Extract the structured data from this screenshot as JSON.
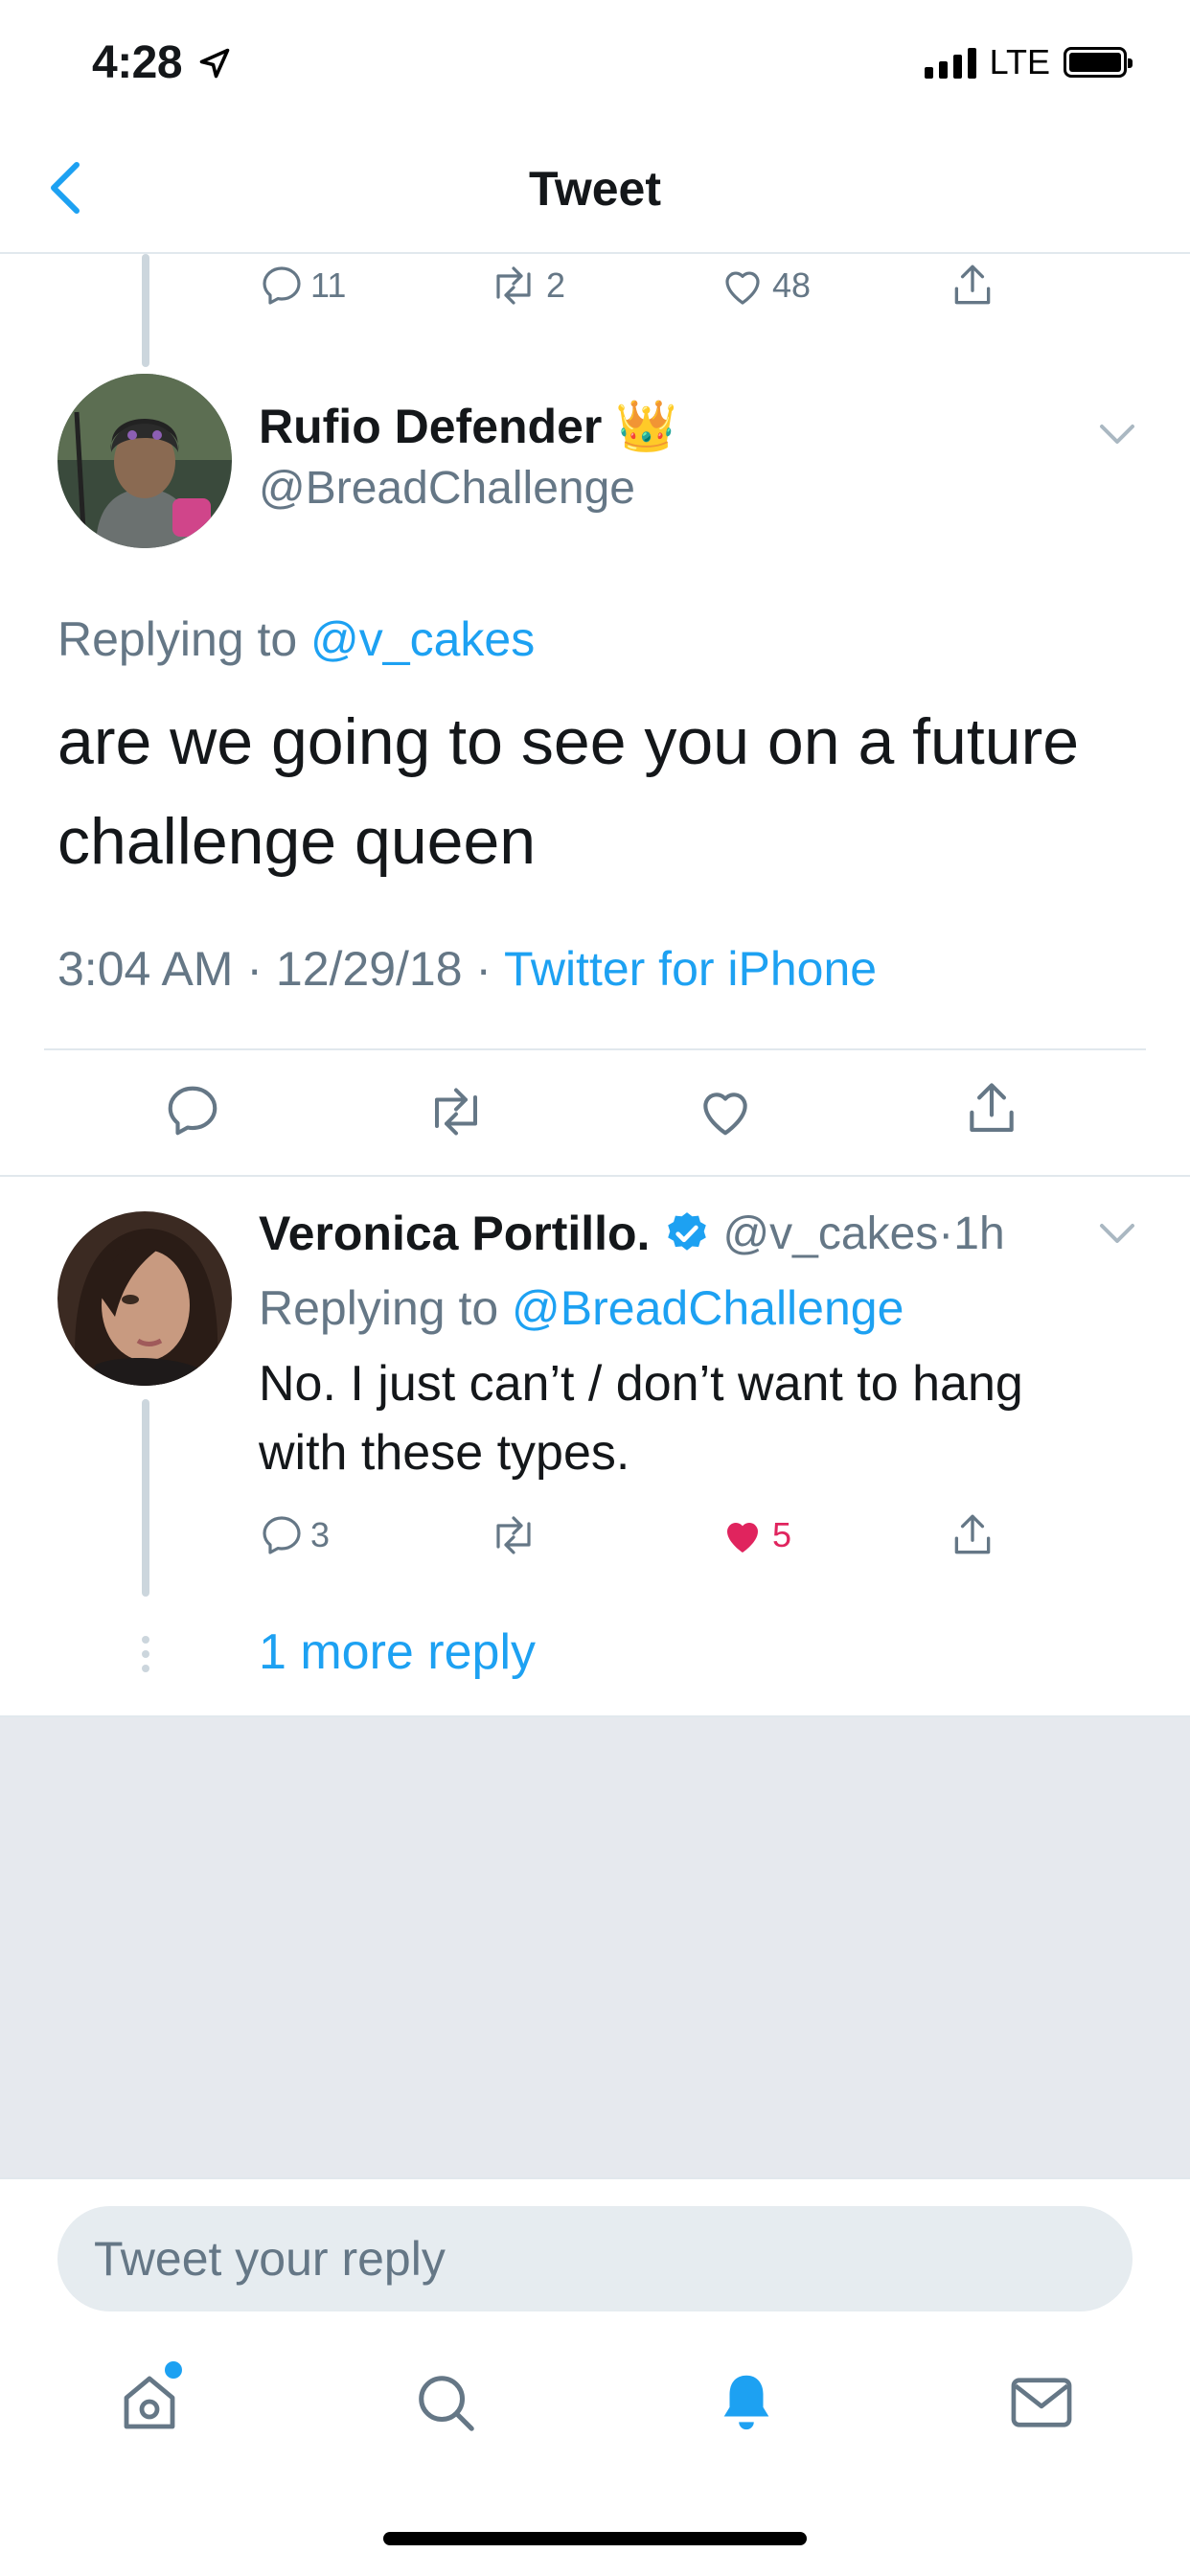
{
  "status_bar": {
    "time": "4:28",
    "network": "LTE"
  },
  "nav": {
    "title": "Tweet"
  },
  "parent_tweet_actions": {
    "replies": "11",
    "retweets": "2",
    "likes": "48"
  },
  "main_tweet": {
    "name": "Rufio Defender",
    "name_emoji": "👑",
    "handle": "@BreadChallenge",
    "replying_prefix": "Replying to ",
    "replying_to": "@v_cakes",
    "text": "are we going to see you on a future challenge queen",
    "timestamp": "3:04 AM · 12/29/18 · ",
    "source": "Twitter for iPhone"
  },
  "reply_tweet": {
    "name": "Veronica Portillo.",
    "handle": "@v_cakes",
    "time": "·1h",
    "replying_prefix": "Replying to ",
    "replying_to": "@BreadChallenge",
    "text": "No. I just can’t / don’t want to hang with these types.",
    "replies": "3",
    "likes": "5"
  },
  "more_replies": "1 more reply",
  "reply_box": {
    "placeholder": "Tweet your reply"
  },
  "colors": {
    "accent": "#1da1f2",
    "like": "#e0245e",
    "secondary": "#657786"
  }
}
